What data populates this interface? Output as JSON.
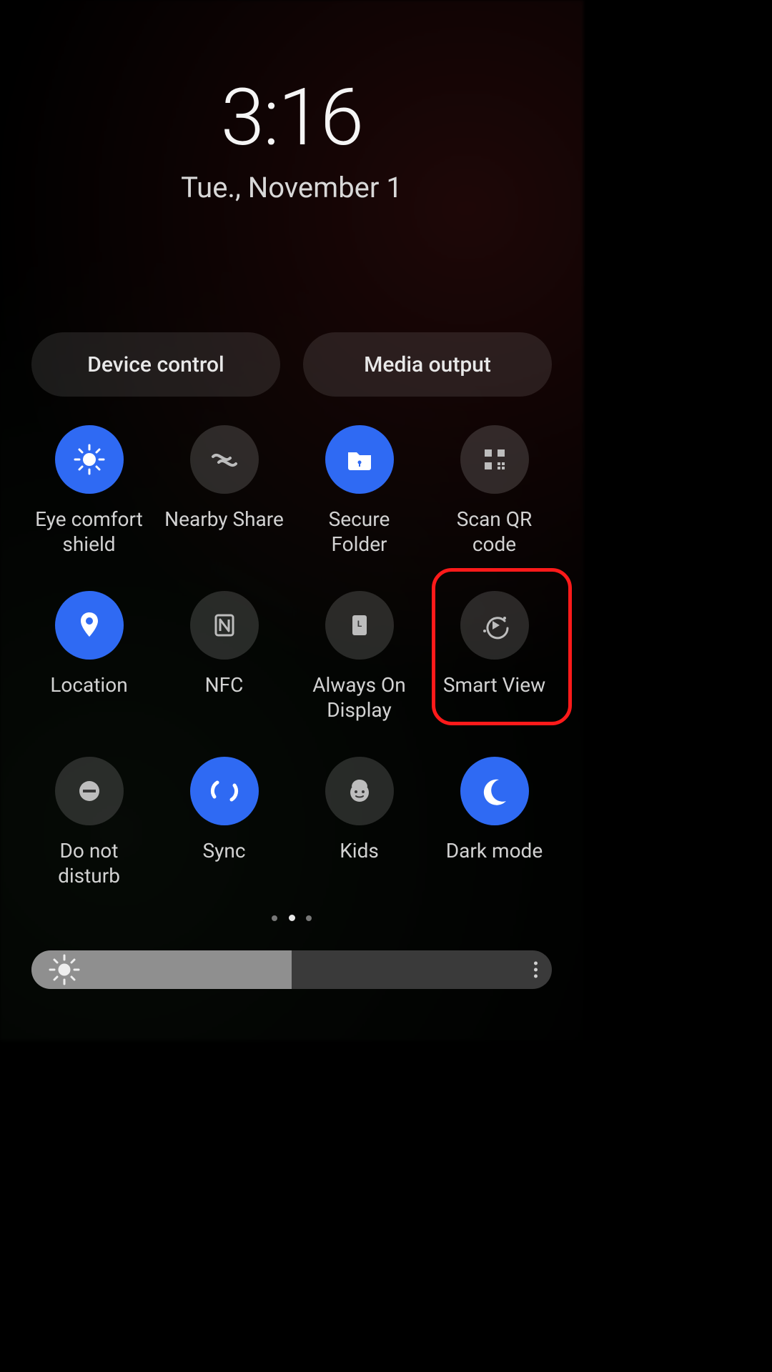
{
  "clock": {
    "time": "3:16",
    "date": "Tue., November 1"
  },
  "pills": {
    "device_control": "Device control",
    "media_output": "Media output"
  },
  "tiles": [
    {
      "id": "eye-comfort-shield",
      "label": "Eye comfort shield",
      "icon": "eye-comfort-icon",
      "state": "on"
    },
    {
      "id": "nearby-share",
      "label": "Nearby Share",
      "icon": "nearby-share-icon",
      "state": "off"
    },
    {
      "id": "secure-folder",
      "label": "Secure Folder",
      "icon": "secure-folder-icon",
      "state": "on"
    },
    {
      "id": "scan-qr-code",
      "label": "Scan QR code",
      "icon": "qr-code-icon",
      "state": "off"
    },
    {
      "id": "location",
      "label": "Location",
      "icon": "location-pin-icon",
      "state": "on"
    },
    {
      "id": "nfc",
      "label": "NFC",
      "icon": "nfc-icon",
      "state": "off"
    },
    {
      "id": "always-on-display",
      "label": "Always On Display",
      "icon": "clock-page-icon",
      "state": "off"
    },
    {
      "id": "smart-view",
      "label": "Smart View",
      "icon": "smart-view-icon",
      "state": "off"
    },
    {
      "id": "do-not-disturb",
      "label": "Do not disturb",
      "icon": "do-not-disturb-icon",
      "state": "off"
    },
    {
      "id": "sync",
      "label": "Sync",
      "icon": "sync-icon",
      "state": "on"
    },
    {
      "id": "kids",
      "label": "Kids",
      "icon": "kids-face-icon",
      "state": "off"
    },
    {
      "id": "dark-mode",
      "label": "Dark mode",
      "icon": "moon-icon",
      "state": "on"
    }
  ],
  "highlight_tile": "smart-view",
  "pagination": {
    "pages": 3,
    "active": 2
  },
  "brightness": {
    "percent": 50
  }
}
